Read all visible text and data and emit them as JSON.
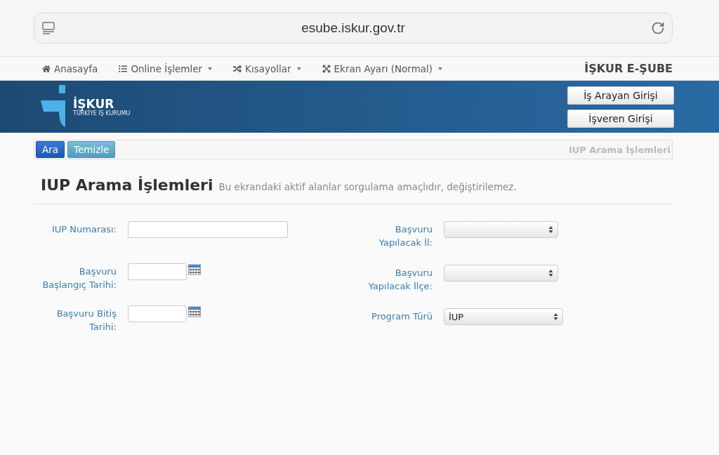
{
  "browser": {
    "url": "esube.iskur.gov.tr"
  },
  "nav": {
    "items": [
      {
        "label": "Anasayfa",
        "dropdown": false
      },
      {
        "label": "Online İşlemler",
        "dropdown": true
      },
      {
        "label": "Kısayollar",
        "dropdown": true
      },
      {
        "label": "Ekran Ayarı (Normal)",
        "dropdown": true
      }
    ],
    "brand": "İŞKUR E-ŞUBE"
  },
  "banner": {
    "logo_title": "İŞKUR",
    "logo_subtitle": "TÜRKİYE İŞ KURUMU",
    "buttons": [
      "İş Arayan Girişi",
      "İşveren Girişi"
    ]
  },
  "toolbar": {
    "buttons": [
      {
        "label": "Ara",
        "kind": "primary"
      },
      {
        "label": "Temizle",
        "kind": "info"
      }
    ],
    "title": "IUP Arama İşlemleri"
  },
  "heading": {
    "title": "IUP Arama İşlemleri",
    "subtitle": "Bu ekrandaki aktif alanlar sorgulama amaçlıdır, değiştirilemez."
  },
  "form": {
    "left": [
      {
        "label": "IUP Numarası:",
        "kind": "text"
      },
      {
        "label": "Başvuru Başlangıç Tarihi:",
        "kind": "date"
      },
      {
        "label": "Başvuru Bitiş Tarihi:",
        "kind": "date"
      }
    ],
    "right": [
      {
        "label": "Başvuru Yapılacak İl:",
        "kind": "select"
      },
      {
        "label": "Başvuru Yapılacak İlçe:",
        "kind": "select"
      },
      {
        "label": "Program Türü",
        "kind": "select",
        "value": "İUP"
      }
    ]
  }
}
